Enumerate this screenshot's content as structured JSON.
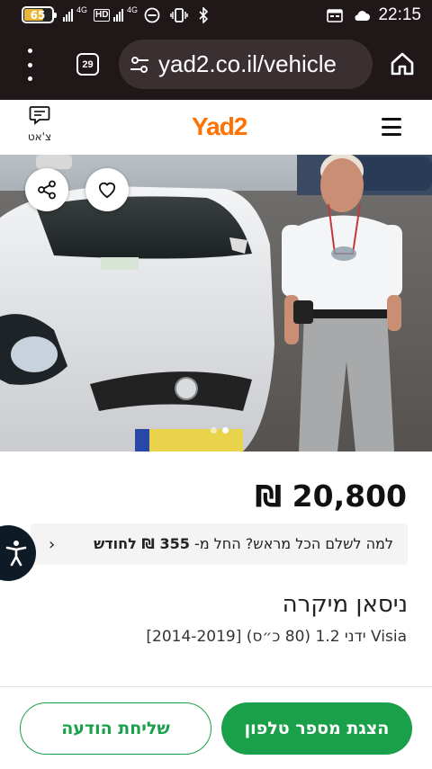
{
  "status_bar": {
    "battery": "65",
    "battery_level": 0.65,
    "net_1": "4G",
    "net_hd": "HD",
    "net_2": "4G",
    "time": "22:15"
  },
  "browser": {
    "tab_count": "29",
    "url": "yad2.co.il/vehicle"
  },
  "header": {
    "logo": "Yad2",
    "chat_label": "צ'אט"
  },
  "gallery": {
    "image_count": 2,
    "active_index": 1
  },
  "listing": {
    "price": "20,800 ₪",
    "finance": {
      "prefix": "למה לשלם הכל מראש? החל מ-",
      "amount": "355 ₪ לחודש"
    },
    "title": "ניסאן מיקרה",
    "subtitle": "Visia ידני 1.2 (80 כ״ס) [2014-2019]"
  },
  "actions": {
    "show_phone": "הצגת מספר טלפון",
    "send_message": "שליחת הודעה"
  },
  "colors": {
    "brand_orange": "#ff7100",
    "action_green": "#1aa04a",
    "browser_dark": "#201719"
  }
}
